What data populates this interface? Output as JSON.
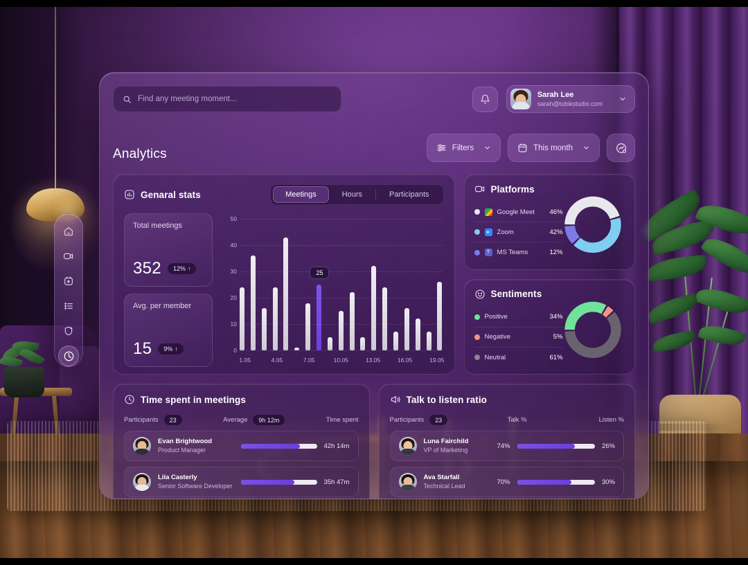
{
  "app": {
    "search": {
      "placeholder": "Find any meeting moment...",
      "value": "",
      "icon": "search-icon"
    },
    "notification_icon": "bell-icon",
    "profile": {
      "name": "Sarah Lee",
      "email": "sarah@tubikstudio.com",
      "chevron": "chevron-down-icon"
    },
    "page_title": "Analytics",
    "controls": {
      "filters_label": "Filters",
      "filters_icon": "sliders-icon",
      "period_label": "This month",
      "period_icon": "calendar-icon",
      "export_icon": "chart-export-icon"
    }
  },
  "sidebar": {
    "items": [
      {
        "name": "home",
        "icon": "home-icon",
        "active": false
      },
      {
        "name": "meetings",
        "icon": "video-camera-icon",
        "active": false
      },
      {
        "name": "recordings",
        "icon": "media-play-icon",
        "active": false
      },
      {
        "name": "tasks",
        "icon": "list-icon",
        "active": false
      },
      {
        "name": "insights",
        "icon": "shield-sparkle-icon",
        "active": false
      },
      {
        "name": "analytics",
        "icon": "clock-analytics-icon",
        "active": true
      }
    ]
  },
  "general_stats": {
    "title": "Genaral stats",
    "icon": "bar-chart-icon",
    "tabs": [
      {
        "label": "Meetings",
        "active": true
      },
      {
        "label": "Hours",
        "active": false
      },
      {
        "label": "Participants",
        "active": false
      }
    ],
    "stats": [
      {
        "label": "Total meetings",
        "value": "352",
        "delta": "12%",
        "trend": "up"
      },
      {
        "label": "Avg. per member",
        "value": "15",
        "delta": "9%",
        "trend": "up"
      }
    ]
  },
  "chart_data": {
    "type": "bar",
    "title": "Genaral stats — Meetings",
    "xlabel": "",
    "ylabel": "",
    "ylim": [
      0,
      50
    ],
    "yticks": [
      0,
      10,
      20,
      30,
      40,
      50
    ],
    "grid": true,
    "legend": "none",
    "categories": [
      "1.05",
      "2.05",
      "3.05",
      "4.05",
      "5.05",
      "6.05",
      "7.05",
      "8.05",
      "9.05",
      "10.05",
      "11.05",
      "12.05",
      "13.05",
      "14.05",
      "15.05",
      "16.05",
      "17.05",
      "18.05",
      "19.05"
    ],
    "tick_labels": [
      "1.05",
      "4.05",
      "7.05",
      "10.05",
      "13.05",
      "16.05",
      "19.05"
    ],
    "tick_indices": [
      0,
      3,
      6,
      9,
      12,
      15,
      18
    ],
    "values": [
      24,
      36,
      16,
      24,
      43,
      1,
      18,
      25,
      5,
      15,
      22,
      5,
      32,
      24,
      7,
      16,
      12,
      7,
      26
    ],
    "highlight_index": 7,
    "highlight_label": "25",
    "bar_color": "#e7e3eb",
    "highlight_color": "#6f45e2"
  },
  "platforms": {
    "title": "Platforms",
    "icon": "video-camera-icon",
    "items": [
      {
        "label": "Google Meet",
        "value": "46%",
        "pct": 46,
        "color": "#e9e7ee",
        "app_icon": "google-meet-icon"
      },
      {
        "label": "Zoom",
        "value": "42%",
        "pct": 42,
        "color": "#7fcdf2",
        "app_icon": "zoom-icon"
      },
      {
        "label": "MS Teams",
        "value": "12%",
        "pct": 12,
        "color": "#7b7ce6",
        "app_icon": "ms-teams-icon"
      }
    ]
  },
  "sentiments": {
    "title": "Sentiments",
    "icon": "smiley-icon",
    "items": [
      {
        "label": "Positive",
        "value": "34%",
        "pct": 34,
        "color": "#70e39b"
      },
      {
        "label": "Negative",
        "value": "5%",
        "pct": 5,
        "color": "#f79384"
      },
      {
        "label": "Neutral",
        "value": "61%",
        "pct": 61,
        "color": "#6b6270"
      }
    ]
  },
  "time_spent": {
    "title": "Time spent in meetings",
    "icon": "clock-icon",
    "participants_label": "Participants",
    "participants_count": "23",
    "average_label": "Average",
    "average_value": "9h 12m",
    "column_label": "Time spent",
    "rows": [
      {
        "name": "Evan Brightwood",
        "role": "Product Manager",
        "value": "42h 14m",
        "pct": 78,
        "avatar": "avatar-evan"
      },
      {
        "name": "Lila Casterly",
        "role": "Senior Software Developer",
        "value": "35h 47m",
        "pct": 70,
        "avatar": "avatar-lila"
      }
    ]
  },
  "talk_listen": {
    "title": "Talk to listen ratio",
    "icon": "megaphone-icon",
    "participants_label": "Participants",
    "participants_count": "23",
    "talk_label": "Talk %",
    "listen_label": "Listen %",
    "rows": [
      {
        "name": "Luna Fairchild",
        "role": "VP of Marketing",
        "talk": "74%",
        "listen": "26%",
        "pct": 74,
        "avatar": "avatar-luna"
      },
      {
        "name": "Ava Starfall",
        "role": "Technical Lead",
        "talk": "70%",
        "listen": "30%",
        "pct": 70,
        "avatar": "avatar-ava"
      }
    ]
  },
  "theme": {
    "accent": "#6f45e2",
    "panel_bg": "#4a2466",
    "text": "#efe6f8",
    "muted": "#c5b2d8",
    "wall": "#4e2264"
  }
}
